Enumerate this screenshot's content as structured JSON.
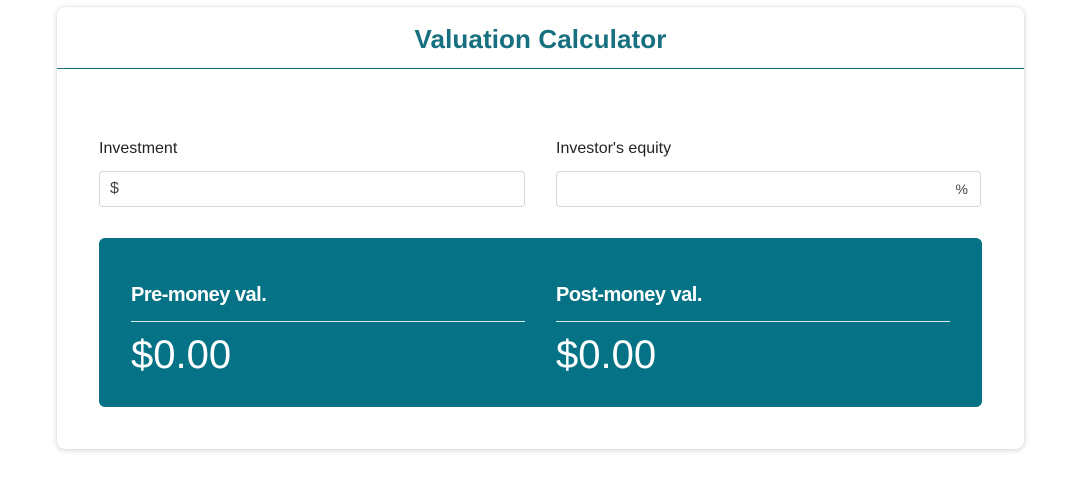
{
  "header": {
    "title": "Valuation Calculator"
  },
  "form": {
    "investment": {
      "label": "Investment",
      "prefix": "$",
      "value": "",
      "placeholder": ""
    },
    "equity": {
      "label": "Investor's equity",
      "suffix": "%",
      "value": "",
      "placeholder": ""
    }
  },
  "results": {
    "pre_money": {
      "label": "Pre-money val.",
      "value": "$0.00"
    },
    "post_money": {
      "label": "Post-money val.",
      "value": "$0.00"
    }
  },
  "colors": {
    "accent": "#17707f",
    "panel": "#057385",
    "panel_text": "#ffffff"
  }
}
